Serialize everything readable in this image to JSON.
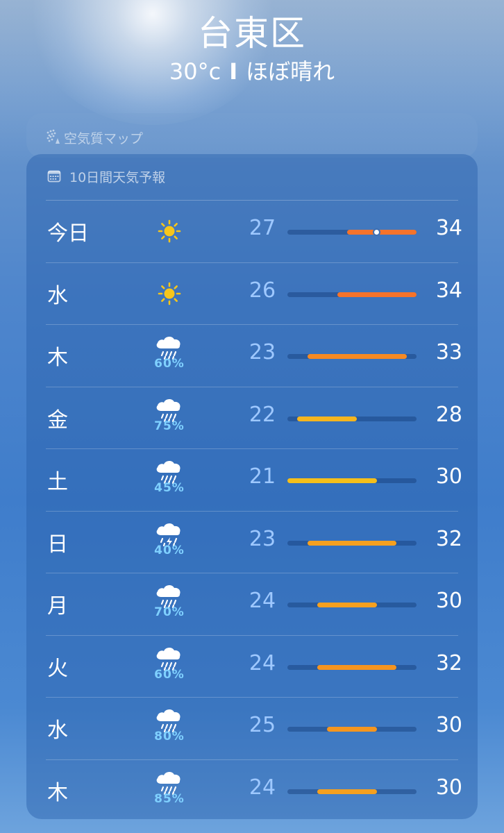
{
  "location": {
    "city": "台東区",
    "temp": "30°c",
    "separator": "I",
    "condition": "ほぼ晴れ"
  },
  "air_quality": {
    "title": "空気質マップ",
    "icon": "air-quality-icon"
  },
  "forecast": {
    "title": "10日間天気予報",
    "icon": "calendar-icon",
    "scale": {
      "min": 21,
      "max": 34
    },
    "current_temp": 30,
    "days": [
      {
        "day": "今日",
        "icon": "sun-icon",
        "precip": "",
        "low": "27",
        "high": "34",
        "bar_color": "#f5732a"
      },
      {
        "day": "水",
        "icon": "sun-icon",
        "precip": "",
        "low": "26",
        "high": "34",
        "bar_color": "#f5732a"
      },
      {
        "day": "木",
        "icon": "rain-icon",
        "precip": "60%",
        "low": "23",
        "high": "33",
        "bar_color": "#f58a24"
      },
      {
        "day": "金",
        "icon": "rain-icon",
        "precip": "75%",
        "low": "22",
        "high": "28",
        "bar_color": "#f5b51e"
      },
      {
        "day": "土",
        "icon": "rain-icon",
        "precip": "45%",
        "low": "21",
        "high": "30",
        "bar_color": "#f5bf1a"
      },
      {
        "day": "日",
        "icon": "thunderstorm-icon",
        "precip": "40%",
        "low": "23",
        "high": "32",
        "bar_color": "#f5a01f"
      },
      {
        "day": "月",
        "icon": "rain-icon",
        "precip": "70%",
        "low": "24",
        "high": "30",
        "bar_color": "#f5a01f"
      },
      {
        "day": "火",
        "icon": "rain-icon",
        "precip": "60%",
        "low": "24",
        "high": "32",
        "bar_color": "#f5941f"
      },
      {
        "day": "水",
        "icon": "rain-icon",
        "precip": "80%",
        "low": "25",
        "high": "30",
        "bar_color": "#f5961f"
      },
      {
        "day": "木",
        "icon": "rain-icon",
        "precip": "85%",
        "low": "24",
        "high": "30",
        "bar_color": "#f5a01f"
      }
    ]
  }
}
